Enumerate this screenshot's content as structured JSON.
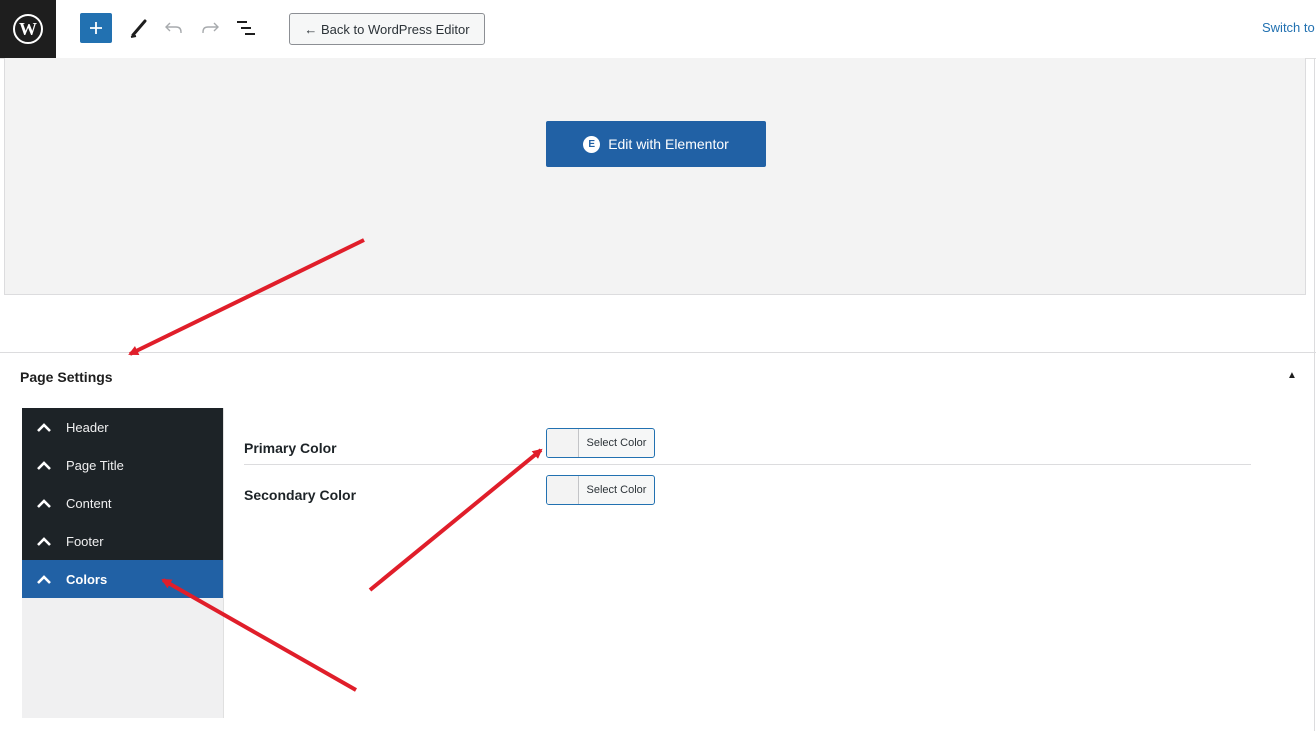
{
  "toolbar": {
    "logo": "wordpress-logo",
    "logo_letter": "W",
    "add_icon": "+",
    "back_label": "← Back to WordPress Editor",
    "switch_label": "Switch to"
  },
  "preview": {
    "button_label": "Edit with Elementor",
    "button_icon": "E",
    "button_color": "#2161a5"
  },
  "settings": {
    "title": "Page Settings",
    "collapse_icon": "▲",
    "tabs": [
      {
        "label": "Header"
      },
      {
        "label": "Page Title"
      },
      {
        "label": "Content"
      },
      {
        "label": "Footer"
      },
      {
        "label": "Colors",
        "active": true
      }
    ],
    "fields": [
      {
        "label": "Primary Color",
        "button": "Select Color"
      },
      {
        "label": "Secondary Color",
        "button": "Select Color"
      }
    ]
  },
  "colors": {
    "accent": "#2271b1",
    "dark": "#1d2327",
    "annotation_arrow": "#e01e2a"
  }
}
